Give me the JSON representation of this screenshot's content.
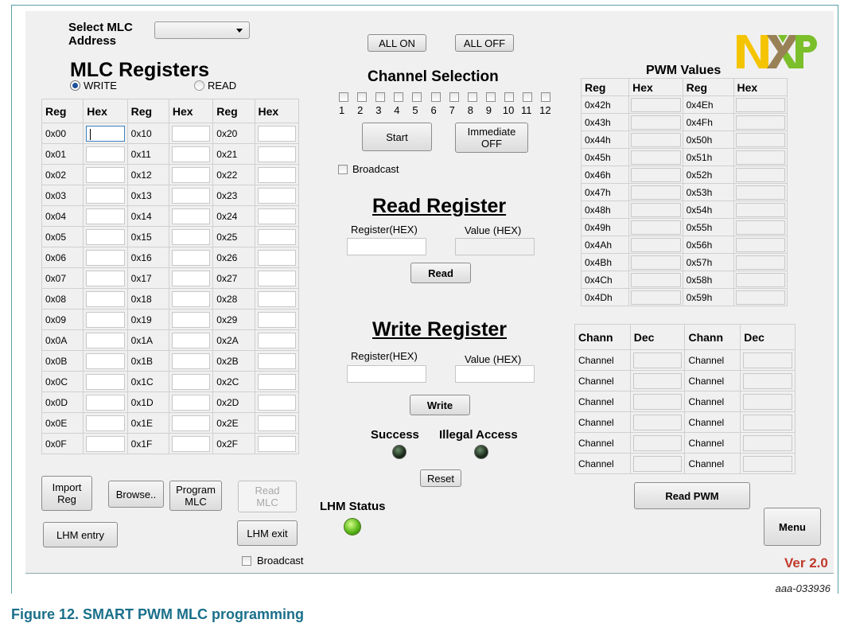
{
  "header": {
    "select_label": "Select MLC\nAddress",
    "dropdown_value": "",
    "registers_title": "MLC Registers",
    "radio_write": "WRITE",
    "radio_read": "READ",
    "logo_text": "NXP"
  },
  "registers_table": {
    "headers": [
      "Reg",
      "Hex",
      "Reg",
      "Hex",
      "Reg",
      "Hex"
    ],
    "col1": [
      "0x00",
      "0x01",
      "0x02",
      "0x03",
      "0x04",
      "0x05",
      "0x06",
      "0x07",
      "0x08",
      "0x09",
      "0x0A",
      "0x0B",
      "0x0C",
      "0x0D",
      "0x0E",
      "0x0F"
    ],
    "col2": [
      "0x10",
      "0x11",
      "0x12",
      "0x13",
      "0x14",
      "0x15",
      "0x16",
      "0x17",
      "0x18",
      "0x19",
      "0x1A",
      "0x1B",
      "0x1C",
      "0x1D",
      "0x1E",
      "0x1F"
    ],
    "col3": [
      "0x20",
      "0x21",
      "0x22",
      "0x23",
      "0x24",
      "0x25",
      "0x26",
      "0x27",
      "0x28",
      "0x29",
      "0x2A",
      "0x2B",
      "0x2C",
      "0x2D",
      "0x2E",
      "0x2F"
    ]
  },
  "left_buttons": {
    "import": "Import\nReg",
    "browse": "Browse..",
    "program": "Program\nMLC",
    "read_mlc": "Read\nMLC",
    "lhm_entry": "LHM entry",
    "lhm_exit": "LHM exit",
    "broadcast": "Broadcast"
  },
  "channel": {
    "all_on": "ALL ON",
    "all_off": "ALL OFF",
    "title": "Channel Selection",
    "numbers": [
      "1",
      "2",
      "3",
      "4",
      "5",
      "6",
      "7",
      "8",
      "9",
      "10",
      "11",
      "12"
    ],
    "start": "Start",
    "immediate_off": "Immediate\nOFF",
    "broadcast": "Broadcast"
  },
  "read_register": {
    "title": "Read Register",
    "reg_label": "Register(HEX)",
    "val_label": "Value (HEX)",
    "button": "Read"
  },
  "write_register": {
    "title": "Write Register",
    "reg_label": "Register(HEX)",
    "val_label": "Value (HEX)",
    "button": "Write"
  },
  "status": {
    "success": "Success",
    "illegal": "Illegal Access",
    "reset": "Reset",
    "lhm_status": "LHM Status"
  },
  "pwm": {
    "title": "PWM Values",
    "headers": [
      "Reg",
      "Hex",
      "Reg",
      "Hex"
    ],
    "col1": [
      "0x42h",
      "0x43h",
      "0x44h",
      "0x45h",
      "0x46h",
      "0x47h",
      "0x48h",
      "0x49h",
      "0x4Ah",
      "0x4Bh",
      "0x4Ch",
      "0x4Dh"
    ],
    "col2": [
      "0x4Eh",
      "0x4Fh",
      "0x50h",
      "0x51h",
      "0x52h",
      "0x53h",
      "0x54h",
      "0x55h",
      "0x56h",
      "0x57h",
      "0x58h",
      "0x59h"
    ]
  },
  "channels_table": {
    "headers": [
      "Chann",
      "Dec",
      "Chann",
      "Dec"
    ],
    "row_label": "Channel",
    "rows": 6,
    "read_pwm": "Read PWM"
  },
  "footer": {
    "menu": "Menu",
    "version": "Ver 2.0",
    "figure_code": "aaa-033936",
    "caption": "Figure 12.  SMART PWM MLC programming"
  },
  "colors": {
    "accent": "#1a6f8a",
    "version": "#c0392b",
    "logo_yellow": "#f5c400",
    "logo_green": "#7bbf2a",
    "logo_blue": "#1b7fc4"
  }
}
